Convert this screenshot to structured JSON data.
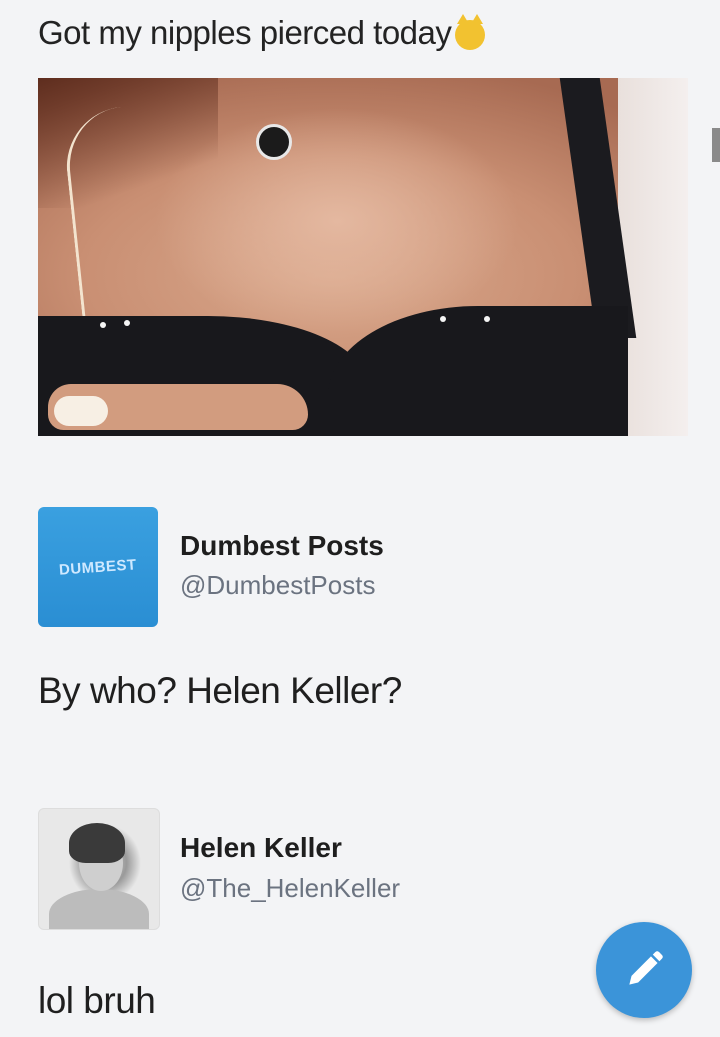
{
  "post": {
    "caption": "Got my nipples pierced today",
    "emoji_icon": "smiling-cat-emoji"
  },
  "reply1": {
    "name": "Dumbest Posts",
    "handle": "@DumbestPosts",
    "avatar_text": "DUMBEST",
    "text": "By who?  Helen Keller?"
  },
  "reply2": {
    "name": "Helen Keller",
    "handle": "@The_HelenKeller",
    "text": "lol bruh"
  },
  "fab": {
    "icon": "pencil-icon",
    "color": "#3b94d9"
  }
}
